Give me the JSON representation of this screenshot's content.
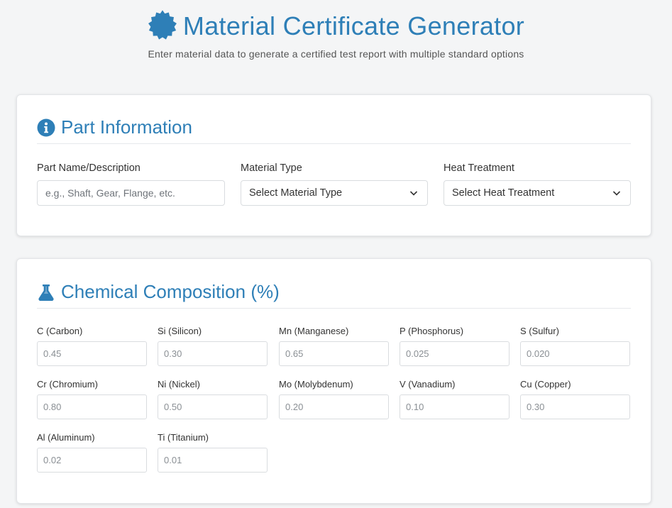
{
  "header": {
    "title": "Material Certificate Generator",
    "subtitle": "Enter material data to generate a certified test report with multiple standard options",
    "icon": "badge-certificate-icon",
    "accent_color": "#2e7fb7"
  },
  "part_info": {
    "title": "Part Information",
    "icon": "info-circle-icon",
    "part_name": {
      "label": "Part Name/Description",
      "value": "",
      "placeholder": "e.g., Shaft, Gear, Flange, etc."
    },
    "material_type": {
      "label": "Material Type",
      "selected": "Select Material Type"
    },
    "heat_treatment": {
      "label": "Heat Treatment",
      "selected": "Select Heat Treatment"
    }
  },
  "chemical": {
    "title": "Chemical Composition (%)",
    "icon": "flask-icon",
    "elements": [
      {
        "label": "C (Carbon)",
        "placeholder": "0.45"
      },
      {
        "label": "Si (Silicon)",
        "placeholder": "0.30"
      },
      {
        "label": "Mn (Manganese)",
        "placeholder": "0.65"
      },
      {
        "label": "P (Phosphorus)",
        "placeholder": "0.025"
      },
      {
        "label": "S (Sulfur)",
        "placeholder": "0.020"
      },
      {
        "label": "Cr (Chromium)",
        "placeholder": "0.80"
      },
      {
        "label": "Ni (Nickel)",
        "placeholder": "0.50"
      },
      {
        "label": "Mo (Molybdenum)",
        "placeholder": "0.20"
      },
      {
        "label": "V (Vanadium)",
        "placeholder": "0.10"
      },
      {
        "label": "Cu (Copper)",
        "placeholder": "0.30"
      },
      {
        "label": "Al (Aluminum)",
        "placeholder": "0.02"
      },
      {
        "label": "Ti (Titanium)",
        "placeholder": "0.01"
      }
    ]
  }
}
